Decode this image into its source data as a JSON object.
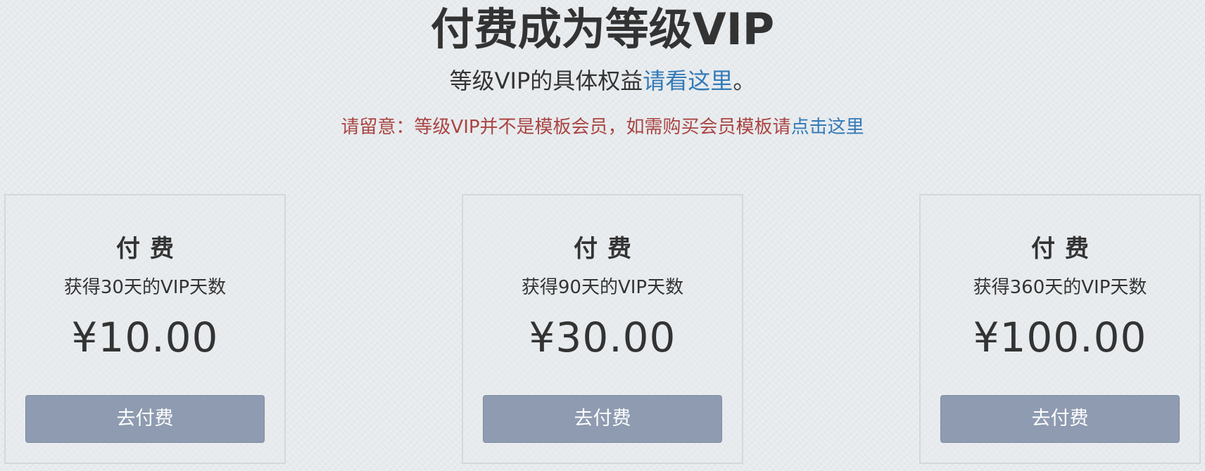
{
  "header": {
    "title": "付费成为等级VIP",
    "subtitle_prefix": "等级VIP的具体权益",
    "subtitle_link": "请看这里",
    "subtitle_suffix": "。"
  },
  "notice": {
    "text": "请留意：等级VIP并不是模板会员，如需购买会员模板请",
    "link": "点击这里"
  },
  "plans": [
    {
      "heading": "付费",
      "description": "获得30天的VIP天数",
      "price": "¥10.00",
      "button_label": "去付费"
    },
    {
      "heading": "付费",
      "description": "获得90天的VIP天数",
      "price": "¥30.00",
      "button_label": "去付费"
    },
    {
      "heading": "付费",
      "description": "获得360天的VIP天数",
      "price": "¥100.00",
      "button_label": "去付费"
    }
  ],
  "colors": {
    "background": "#e7ebee",
    "link": "#337ab7",
    "notice": "#a94442",
    "button": "#8e9bb0"
  }
}
